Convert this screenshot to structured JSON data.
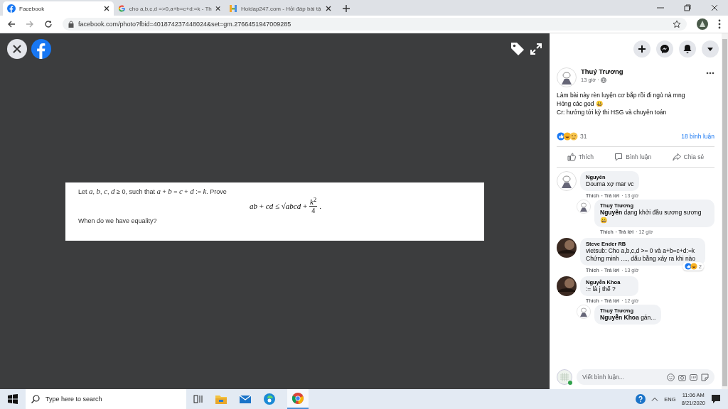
{
  "browser": {
    "tabs": [
      {
        "title": "Facebook",
        "selected": true
      },
      {
        "title": "cho a,b,c,d =>0,a+b=c+d:=k - Th",
        "selected": false
      },
      {
        "title": "Hoidap247.com - Hỏi đáp bài tậ",
        "selected": false
      }
    ],
    "url": "facebook.com/photo?fbid=401874237448024&set=gm.2766451947009285"
  },
  "photo": {
    "problem": "Let *a*, *b*, *c*, *d* ≥ 0, such that *a* + *b* = *c* + *d* := *k*. Prove",
    "formula": {
      "left": "*ab* + *cd* ≤ √*abcd* +",
      "numerator": "*k*$^{2}$",
      "denominator": "4",
      "end": "."
    },
    "question": "When do we have equality?"
  },
  "post": {
    "author": "Thuý Trương",
    "time": "13 giờ ·",
    "text": [
      "Làm bài này rèn luyện cơ bắp rồi đi ngủ nà mng",
      "Hóng các god 😀",
      "Cr: hướng tới kỳ thi HSG và chuyên toán"
    ],
    "reaction_count": "31",
    "comment_count": "18 bình luận",
    "actions": [
      "Thích",
      "Bình luận",
      "Chia sẻ"
    ]
  },
  "comments": [
    {
      "kind": "drawing",
      "author": "Nguyên",
      "text": "Douma xợ mar vc",
      "like": "Thích",
      "reply": "· Trả lời",
      "time": "· 13 giờ",
      "children": [
        {
          "kind": "drawing",
          "author": "Thuý Trương",
          "text": "**Nguyên** dạng khởi đầu sương sương 😀",
          "like": "Thích",
          "reply": "· Trả lời",
          "time": "· 12 giờ"
        }
      ]
    },
    {
      "kind": "picture",
      "author": "Steve Ender RB",
      "text": "vietsub: Cho a,b,c,d >= 0 và a+b=c+d:=k Chứng minh ...., dấu bằng xảy ra khi nào",
      "like": "Thích",
      "reply": "· Trả lời",
      "time": "· 13 giờ",
      "reactions": "2"
    },
    {
      "kind": "picture",
      "author": "Nguyễn Khoa",
      "text": ":= là j thế ?",
      "like": "Thích",
      "reply": "· Trả lời",
      "time": "· 12 giờ",
      "children": [
        {
          "kind": "drawing",
          "author": "Thuý Trương",
          "text": "**Nguyễn Khoa** gán..."
        }
      ]
    }
  ],
  "comment_box": {
    "placeholder": "Viết bình luận..."
  },
  "taskbar": {
    "search_placeholder": "Type here to search",
    "language": "ENG",
    "time": "11:06 AM",
    "date": "8/21/2020"
  }
}
